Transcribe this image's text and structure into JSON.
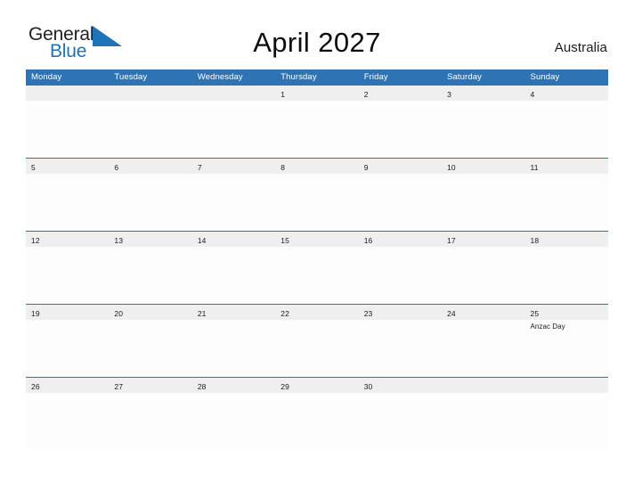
{
  "brand": {
    "name_part1": "General",
    "name_part2": "Blue",
    "flag_icon": "blue-triangle-flag-icon",
    "color_dark": "#231f20",
    "color_blue": "#1f73b8"
  },
  "header": {
    "title": "April 2027",
    "country": "Australia"
  },
  "theme": {
    "header_blue": "#2e74b5",
    "band_gray": "#efefef",
    "page_background": "#ffffff",
    "text_dark": "#1a1a1a"
  },
  "calendar": {
    "weekdays": [
      "Monday",
      "Tuesday",
      "Wednesday",
      "Thursday",
      "Friday",
      "Saturday",
      "Sunday"
    ],
    "weeks": [
      [
        {
          "day": ""
        },
        {
          "day": ""
        },
        {
          "day": ""
        },
        {
          "day": "1",
          "events": []
        },
        {
          "day": "2",
          "events": []
        },
        {
          "day": "3",
          "events": []
        },
        {
          "day": "4",
          "events": []
        }
      ],
      [
        {
          "day": "5",
          "events": []
        },
        {
          "day": "6",
          "events": []
        },
        {
          "day": "7",
          "events": []
        },
        {
          "day": "8",
          "events": []
        },
        {
          "day": "9",
          "events": []
        },
        {
          "day": "10",
          "events": []
        },
        {
          "day": "11",
          "events": []
        }
      ],
      [
        {
          "day": "12",
          "events": []
        },
        {
          "day": "13",
          "events": []
        },
        {
          "day": "14",
          "events": []
        },
        {
          "day": "15",
          "events": []
        },
        {
          "day": "16",
          "events": []
        },
        {
          "day": "17",
          "events": []
        },
        {
          "day": "18",
          "events": []
        }
      ],
      [
        {
          "day": "19",
          "events": []
        },
        {
          "day": "20",
          "events": []
        },
        {
          "day": "21",
          "events": []
        },
        {
          "day": "22",
          "events": []
        },
        {
          "day": "23",
          "events": []
        },
        {
          "day": "24",
          "events": []
        },
        {
          "day": "25",
          "events": [
            "Anzac Day"
          ]
        }
      ],
      [
        {
          "day": "26",
          "events": []
        },
        {
          "day": "27",
          "events": []
        },
        {
          "day": "28",
          "events": []
        },
        {
          "day": "29",
          "events": []
        },
        {
          "day": "30",
          "events": []
        },
        {
          "day": ""
        },
        {
          "day": ""
        }
      ]
    ]
  }
}
